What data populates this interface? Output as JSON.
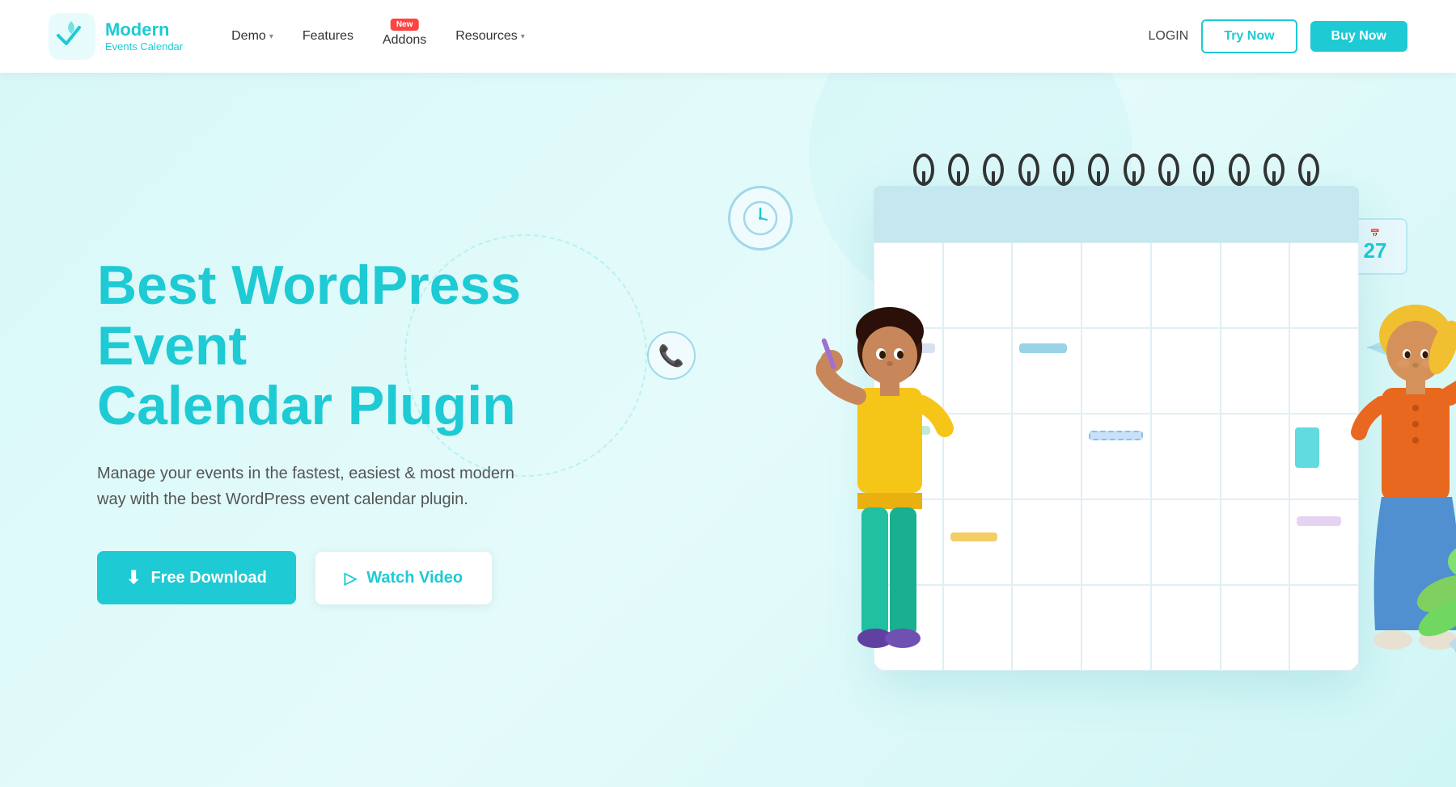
{
  "nav": {
    "logo_main": "Modern",
    "logo_sub": "Events Calendar",
    "links": [
      {
        "label": "Demo",
        "has_dropdown": true
      },
      {
        "label": "Features",
        "has_dropdown": false
      },
      {
        "label": "Addons",
        "has_dropdown": false,
        "badge": "New"
      },
      {
        "label": "Resources",
        "has_dropdown": true
      }
    ],
    "login_label": "LOGIN",
    "try_label": "Try Now",
    "buy_label": "Buy Now"
  },
  "hero": {
    "title_line1": "Best WordPress Event",
    "title_line2": "Calendar Plugin",
    "description": "Manage your events in the fastest, easiest & most modern way with the best WordPress event calendar plugin.",
    "btn_download": "Free Download",
    "btn_video": "Watch Video"
  },
  "calendar_mini": {
    "day": "27"
  },
  "colors": {
    "primary": "#1ecad3",
    "background": "#e0f8f8"
  }
}
